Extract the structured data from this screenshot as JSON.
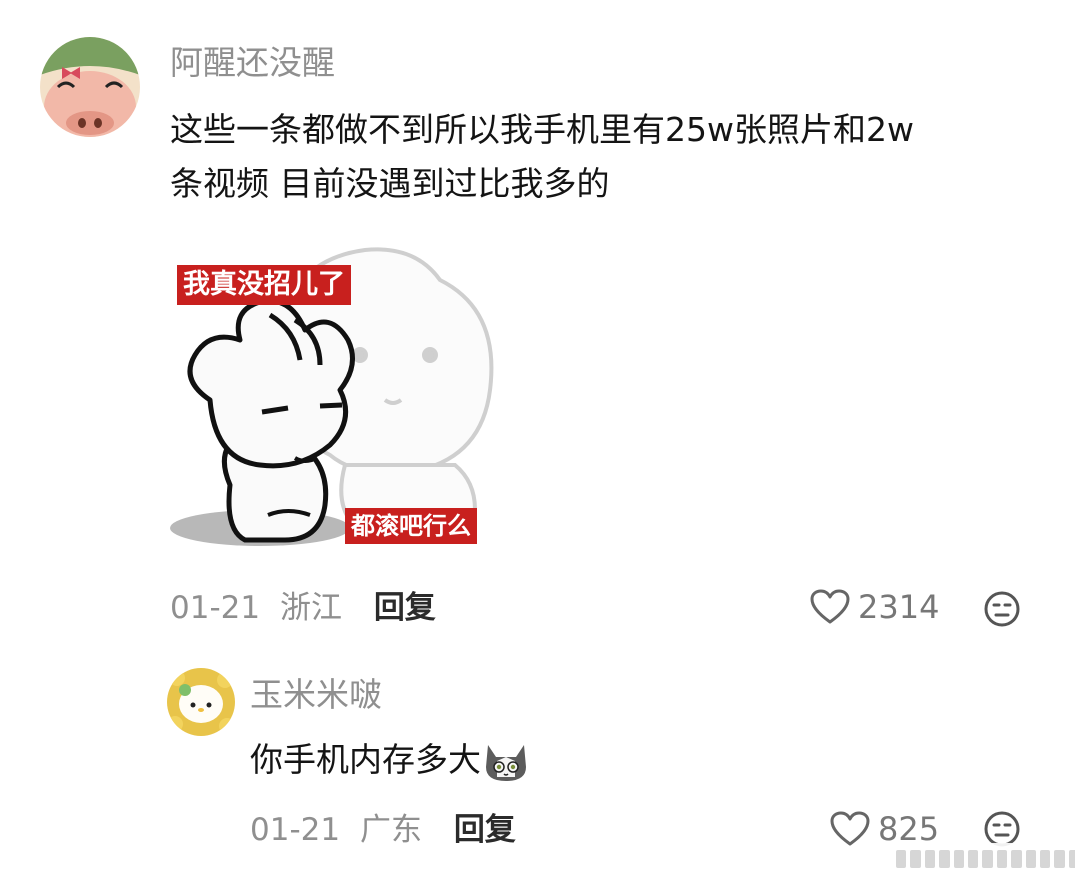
{
  "comments": [
    {
      "username": "阿醒还没醒",
      "text_line1": "这些一条都做不到所以我手机里有25w张照片和2w",
      "text_line2": "条视频 目前没遇到过比我多的",
      "sticker": {
        "top_label": "我真没招儿了",
        "bottom_label": "都滚吧行么"
      },
      "date": "01-21",
      "location": "浙江",
      "reply_label": "回复",
      "likes": "2314"
    },
    {
      "username": "玉米米啵",
      "text": "你手机内存多大",
      "date": "01-21",
      "location": "广东",
      "reply_label": "回复",
      "likes": "825"
    }
  ],
  "icons": {
    "like": "heart-outline-icon",
    "react": "expressionless-face-icon",
    "emoji": "gray-cat-emoji"
  },
  "colors": {
    "username": "#8f8f8f",
    "text": "#141414",
    "sticker_label_bg": "#c8201e"
  }
}
